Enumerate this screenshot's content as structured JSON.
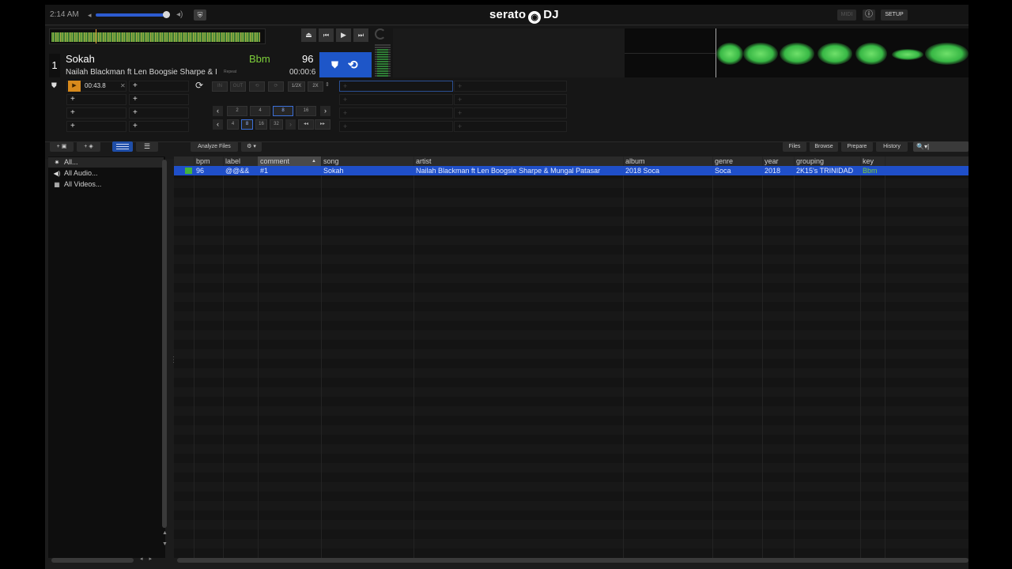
{
  "topbar": {
    "clock": "2:14 AM",
    "volume_fraction": 0.95,
    "logo_text_left": "serato",
    "logo_text_right": "DJ",
    "midi_label": "MIDI",
    "setup_label": "SETUP"
  },
  "deck": {
    "number": "1",
    "title": "Sokah",
    "artist": "Nailah Blackman ft Len Boogsie Sharpe & I",
    "repeat_label": "Repeat",
    "key": "Bbm",
    "bpm": "96",
    "time": "00:00:6",
    "cue1_time": "00:43.8"
  },
  "loop_controls": {
    "in": "IN",
    "out": "OUT",
    "half": "1/2X",
    "double": "2X",
    "row1": [
      "2",
      "4",
      "8",
      "16"
    ],
    "row2": [
      "4",
      "8",
      "16",
      "32"
    ]
  },
  "library": {
    "analyze_label": "Analyze Files",
    "tabs": [
      "Files",
      "Browse",
      "Prepare",
      "History"
    ],
    "crates": [
      "All...",
      "All Audio...",
      "All Videos..."
    ],
    "columns": [
      "bpm",
      "label",
      "comment",
      "song",
      "artist",
      "album",
      "genre",
      "year",
      "grouping",
      "key"
    ],
    "rows": [
      {
        "bpm": "96",
        "label": "@@&&",
        "comment": "#1",
        "song": "Sokah",
        "artist": "Nailah Blackman ft Len Boogsie Sharpe & Mungal Patasar",
        "album": "2018 Soca",
        "genre": "Soca",
        "year": "2018",
        "grouping": "2K15's TRINIDAD",
        "key": "Bbm"
      }
    ]
  },
  "colors": {
    "accent_blue": "#1f4fc9",
    "key_green": "#7dcf3a",
    "cue_orange": "#d88a1c"
  }
}
